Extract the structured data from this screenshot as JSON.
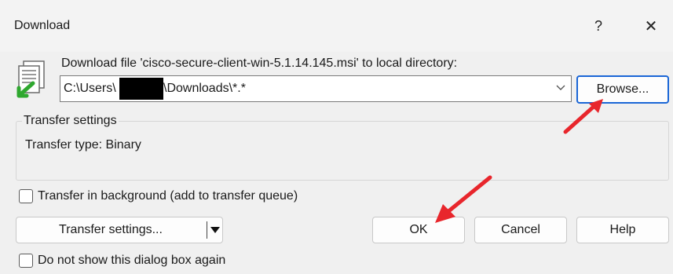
{
  "window": {
    "title": "Download",
    "help_glyph": "?",
    "close_glyph": "✕"
  },
  "main": {
    "label": "Download file 'cisco-secure-client-win-5.1.14.145.msi' to local directory:",
    "path_prefix": "C:\\Users\\",
    "path_suffix": "\\Downloads\\*.*",
    "browse_label": "Browse..."
  },
  "transfer_settings": {
    "legend": "Transfer settings",
    "transfer_type": "Transfer type: Binary"
  },
  "options": {
    "background_label": "Transfer in background (add to transfer queue)",
    "background_checked": false,
    "no_show_label": "Do not show this dialog box again",
    "no_show_checked": false
  },
  "buttons": {
    "transfer_settings": "Transfer settings...",
    "ok": "OK",
    "cancel": "Cancel",
    "help": "Help"
  },
  "colors": {
    "annotation_arrow": "#e8262c",
    "focus_border": "#1a66d6"
  }
}
